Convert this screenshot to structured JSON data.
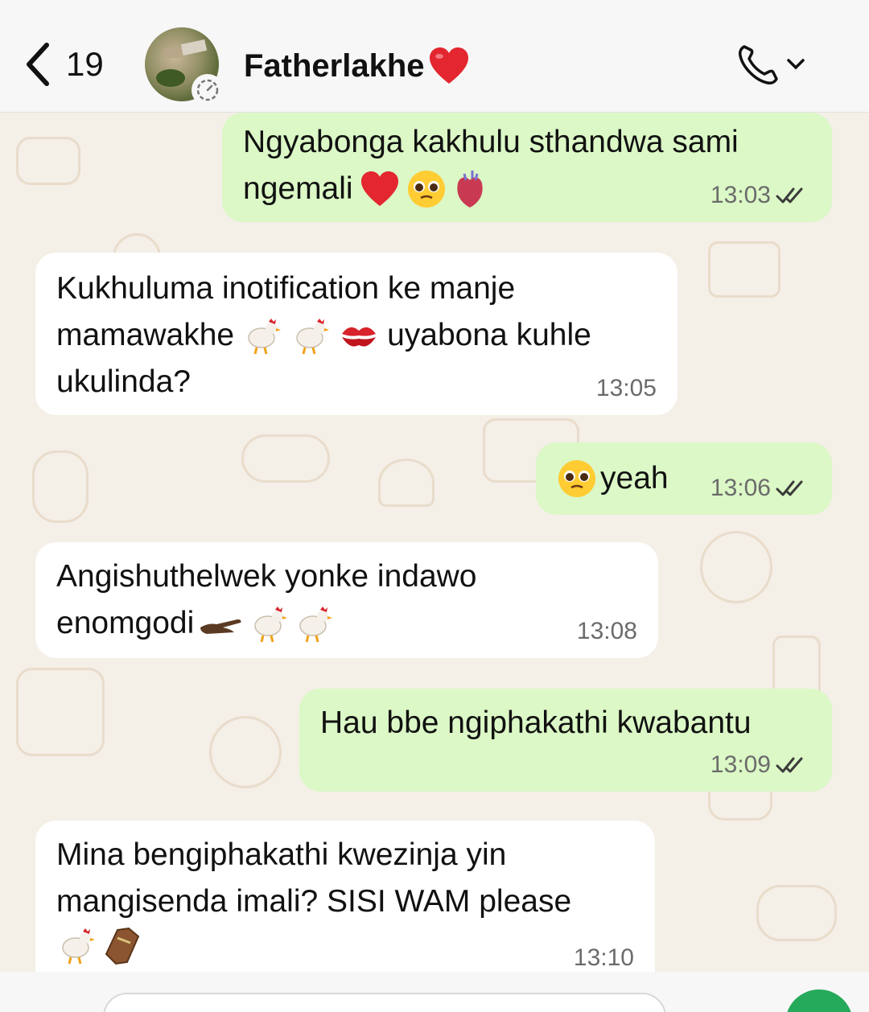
{
  "header": {
    "back_count": "19",
    "contact_name": "Fatherlakhe"
  },
  "messages": [
    {
      "dir": "out",
      "lines": [
        "Ngyabonga kakhulu sthandwa sami",
        "ngemali"
      ],
      "time": "13:03",
      "read": true
    },
    {
      "dir": "in",
      "lines": [
        "Kukhuluma inotification ke manje",
        "mamawakhe",
        "uyabona kuhle",
        "ukulinda?"
      ],
      "time": "13:05"
    },
    {
      "dir": "out",
      "lines": [
        "yeah"
      ],
      "time": "13:06",
      "read": true
    },
    {
      "dir": "in",
      "lines": [
        "Angishuthelwek yonke indawo",
        "enomgodi"
      ],
      "time": "13:08"
    },
    {
      "dir": "out",
      "lines": [
        "Hau bbe ngiphakathi kwabantu"
      ],
      "time": "13:09",
      "read": true
    },
    {
      "dir": "in",
      "lines": [
        "Mina bengiphakathi kwezinja yin",
        "mangisenda imali? SISI WAM please"
      ],
      "time": "13:10"
    }
  ],
  "colors": {
    "outgoing_bubble": "#dbf8c6",
    "incoming_bubble": "#ffffff",
    "wallpaper": "#f4efe7",
    "tick_blue": "#4a4a4a"
  },
  "icons": [
    "back-chevron-icon",
    "status-icon",
    "heart-emoji",
    "phone-icon",
    "chevron-down-icon",
    "pleading-face-emoji",
    "anatomical-heart-emoji",
    "rooster-emoji",
    "kiss-mark-emoji",
    "hand-emoji",
    "coffin-emoji",
    "double-check-icon"
  ]
}
